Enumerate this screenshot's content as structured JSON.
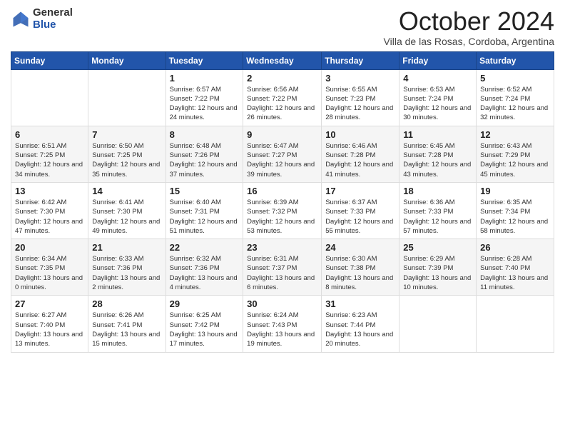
{
  "logo": {
    "general": "General",
    "blue": "Blue"
  },
  "header": {
    "month": "October 2024",
    "location": "Villa de las Rosas, Cordoba, Argentina"
  },
  "weekdays": [
    "Sunday",
    "Monday",
    "Tuesday",
    "Wednesday",
    "Thursday",
    "Friday",
    "Saturday"
  ],
  "weeks": [
    [
      {
        "day": "",
        "detail": ""
      },
      {
        "day": "",
        "detail": ""
      },
      {
        "day": "1",
        "detail": "Sunrise: 6:57 AM\nSunset: 7:22 PM\nDaylight: 12 hours and 24 minutes."
      },
      {
        "day": "2",
        "detail": "Sunrise: 6:56 AM\nSunset: 7:22 PM\nDaylight: 12 hours and 26 minutes."
      },
      {
        "day": "3",
        "detail": "Sunrise: 6:55 AM\nSunset: 7:23 PM\nDaylight: 12 hours and 28 minutes."
      },
      {
        "day": "4",
        "detail": "Sunrise: 6:53 AM\nSunset: 7:24 PM\nDaylight: 12 hours and 30 minutes."
      },
      {
        "day": "5",
        "detail": "Sunrise: 6:52 AM\nSunset: 7:24 PM\nDaylight: 12 hours and 32 minutes."
      }
    ],
    [
      {
        "day": "6",
        "detail": "Sunrise: 6:51 AM\nSunset: 7:25 PM\nDaylight: 12 hours and 34 minutes."
      },
      {
        "day": "7",
        "detail": "Sunrise: 6:50 AM\nSunset: 7:25 PM\nDaylight: 12 hours and 35 minutes."
      },
      {
        "day": "8",
        "detail": "Sunrise: 6:48 AM\nSunset: 7:26 PM\nDaylight: 12 hours and 37 minutes."
      },
      {
        "day": "9",
        "detail": "Sunrise: 6:47 AM\nSunset: 7:27 PM\nDaylight: 12 hours and 39 minutes."
      },
      {
        "day": "10",
        "detail": "Sunrise: 6:46 AM\nSunset: 7:28 PM\nDaylight: 12 hours and 41 minutes."
      },
      {
        "day": "11",
        "detail": "Sunrise: 6:45 AM\nSunset: 7:28 PM\nDaylight: 12 hours and 43 minutes."
      },
      {
        "day": "12",
        "detail": "Sunrise: 6:43 AM\nSunset: 7:29 PM\nDaylight: 12 hours and 45 minutes."
      }
    ],
    [
      {
        "day": "13",
        "detail": "Sunrise: 6:42 AM\nSunset: 7:30 PM\nDaylight: 12 hours and 47 minutes."
      },
      {
        "day": "14",
        "detail": "Sunrise: 6:41 AM\nSunset: 7:30 PM\nDaylight: 12 hours and 49 minutes."
      },
      {
        "day": "15",
        "detail": "Sunrise: 6:40 AM\nSunset: 7:31 PM\nDaylight: 12 hours and 51 minutes."
      },
      {
        "day": "16",
        "detail": "Sunrise: 6:39 AM\nSunset: 7:32 PM\nDaylight: 12 hours and 53 minutes."
      },
      {
        "day": "17",
        "detail": "Sunrise: 6:37 AM\nSunset: 7:33 PM\nDaylight: 12 hours and 55 minutes."
      },
      {
        "day": "18",
        "detail": "Sunrise: 6:36 AM\nSunset: 7:33 PM\nDaylight: 12 hours and 57 minutes."
      },
      {
        "day": "19",
        "detail": "Sunrise: 6:35 AM\nSunset: 7:34 PM\nDaylight: 12 hours and 58 minutes."
      }
    ],
    [
      {
        "day": "20",
        "detail": "Sunrise: 6:34 AM\nSunset: 7:35 PM\nDaylight: 13 hours and 0 minutes."
      },
      {
        "day": "21",
        "detail": "Sunrise: 6:33 AM\nSunset: 7:36 PM\nDaylight: 13 hours and 2 minutes."
      },
      {
        "day": "22",
        "detail": "Sunrise: 6:32 AM\nSunset: 7:36 PM\nDaylight: 13 hours and 4 minutes."
      },
      {
        "day": "23",
        "detail": "Sunrise: 6:31 AM\nSunset: 7:37 PM\nDaylight: 13 hours and 6 minutes."
      },
      {
        "day": "24",
        "detail": "Sunrise: 6:30 AM\nSunset: 7:38 PM\nDaylight: 13 hours and 8 minutes."
      },
      {
        "day": "25",
        "detail": "Sunrise: 6:29 AM\nSunset: 7:39 PM\nDaylight: 13 hours and 10 minutes."
      },
      {
        "day": "26",
        "detail": "Sunrise: 6:28 AM\nSunset: 7:40 PM\nDaylight: 13 hours and 11 minutes."
      }
    ],
    [
      {
        "day": "27",
        "detail": "Sunrise: 6:27 AM\nSunset: 7:40 PM\nDaylight: 13 hours and 13 minutes."
      },
      {
        "day": "28",
        "detail": "Sunrise: 6:26 AM\nSunset: 7:41 PM\nDaylight: 13 hours and 15 minutes."
      },
      {
        "day": "29",
        "detail": "Sunrise: 6:25 AM\nSunset: 7:42 PM\nDaylight: 13 hours and 17 minutes."
      },
      {
        "day": "30",
        "detail": "Sunrise: 6:24 AM\nSunset: 7:43 PM\nDaylight: 13 hours and 19 minutes."
      },
      {
        "day": "31",
        "detail": "Sunrise: 6:23 AM\nSunset: 7:44 PM\nDaylight: 13 hours and 20 minutes."
      },
      {
        "day": "",
        "detail": ""
      },
      {
        "day": "",
        "detail": ""
      }
    ]
  ]
}
